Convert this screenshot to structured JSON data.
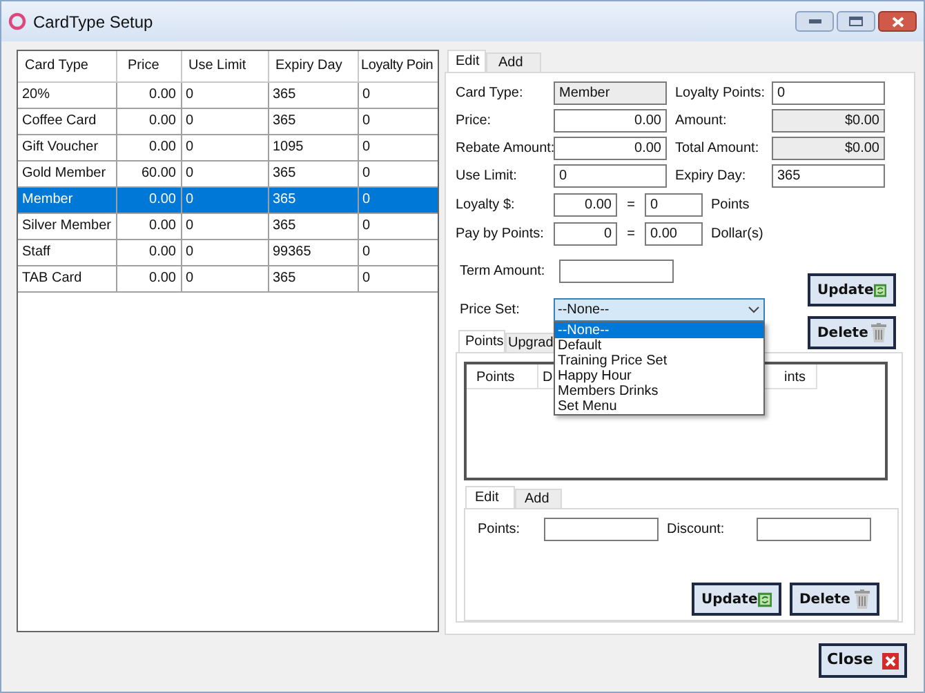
{
  "window": {
    "title": "CardType Setup"
  },
  "table": {
    "columns": [
      "Card Type",
      "Price",
      "Use Limit",
      "Expiry Day",
      "Loyalty Poin"
    ],
    "rows": [
      {
        "cells": [
          "20%",
          "0.00",
          "0",
          "365",
          "0"
        ],
        "selected": false
      },
      {
        "cells": [
          "Coffee Card",
          "0.00",
          "0",
          "365",
          "0"
        ],
        "selected": false
      },
      {
        "cells": [
          "Gift Voucher",
          "0.00",
          "0",
          "1095",
          "0"
        ],
        "selected": false
      },
      {
        "cells": [
          "Gold Member",
          "60.00",
          "0",
          "365",
          "0"
        ],
        "selected": false
      },
      {
        "cells": [
          "Member",
          "0.00",
          "0",
          "365",
          "0"
        ],
        "selected": true
      },
      {
        "cells": [
          "Silver Member",
          "0.00",
          "0",
          "365",
          "0"
        ],
        "selected": false
      },
      {
        "cells": [
          "Staff",
          "0.00",
          "0",
          "99365",
          "0"
        ],
        "selected": false
      },
      {
        "cells": [
          "TAB Card",
          "0.00",
          "0",
          "365",
          "0"
        ],
        "selected": false
      }
    ]
  },
  "edit_tabs": [
    {
      "label": "Edit",
      "selected": true
    },
    {
      "label": "Add",
      "selected": false
    }
  ],
  "form_rows": [
    {
      "left": {
        "label": "Card Type:",
        "value": "Member",
        "kind": "text",
        "readonly": true
      },
      "right": {
        "label": "Loyalty Points:",
        "value": "0",
        "kind": "text",
        "readonly": false
      }
    },
    {
      "left": {
        "label": "Price:",
        "value": "0.00",
        "kind": "number",
        "readonly": false
      },
      "right": {
        "label": "Amount:",
        "value": "$0.00",
        "kind": "number",
        "readonly": true
      }
    },
    {
      "left": {
        "label": "Rebate Amount:",
        "value": "0.00",
        "kind": "number",
        "readonly": false
      },
      "right": {
        "label": "Total Amount:",
        "value": "$0.00",
        "kind": "number",
        "readonly": true
      }
    },
    {
      "left": {
        "label": "Use Limit:",
        "value": "0",
        "kind": "text",
        "readonly": false
      },
      "right": {
        "label": "Expiry Day:",
        "value": "365",
        "kind": "text",
        "readonly": false
      }
    }
  ],
  "conversions": [
    {
      "label": "Loyalty $:",
      "from": "0.00",
      "equals": "=",
      "to": "0",
      "unit": "Points"
    },
    {
      "label": "Pay by Points:",
      "from": "0",
      "equals": "=",
      "to": "0.00",
      "unit": "Dollar(s)"
    }
  ],
  "term_amount": {
    "label": "Term Amount:"
  },
  "price_set": {
    "label": "Price Set:",
    "value": "--None--",
    "expanded": true,
    "options": [
      {
        "label": "--None--",
        "selected": true
      },
      {
        "label": "Default",
        "selected": false
      },
      {
        "label": "Training Price Set",
        "selected": false
      },
      {
        "label": "Happy Hour",
        "selected": false
      },
      {
        "label": "Members Drinks",
        "selected": false
      },
      {
        "label": "Set Menu",
        "selected": false
      }
    ]
  },
  "buttons": [
    "Update",
    "Delete"
  ],
  "inner_tabs": [
    {
      "label": "Points",
      "selected": true
    },
    {
      "label": "Upgrad",
      "selected": false
    }
  ],
  "points_list": {
    "columns": [
      "Points",
      "D",
      "ints"
    ]
  },
  "lower_tabs": [
    {
      "label": "Edit",
      "selected": true
    },
    {
      "label": "Add",
      "selected": false
    }
  ],
  "lower_fields": [
    {
      "label": "Points:"
    },
    {
      "label": "Discount:"
    }
  ],
  "lower_buttons": [
    "Update",
    "Delete"
  ],
  "close_button": "Close"
}
